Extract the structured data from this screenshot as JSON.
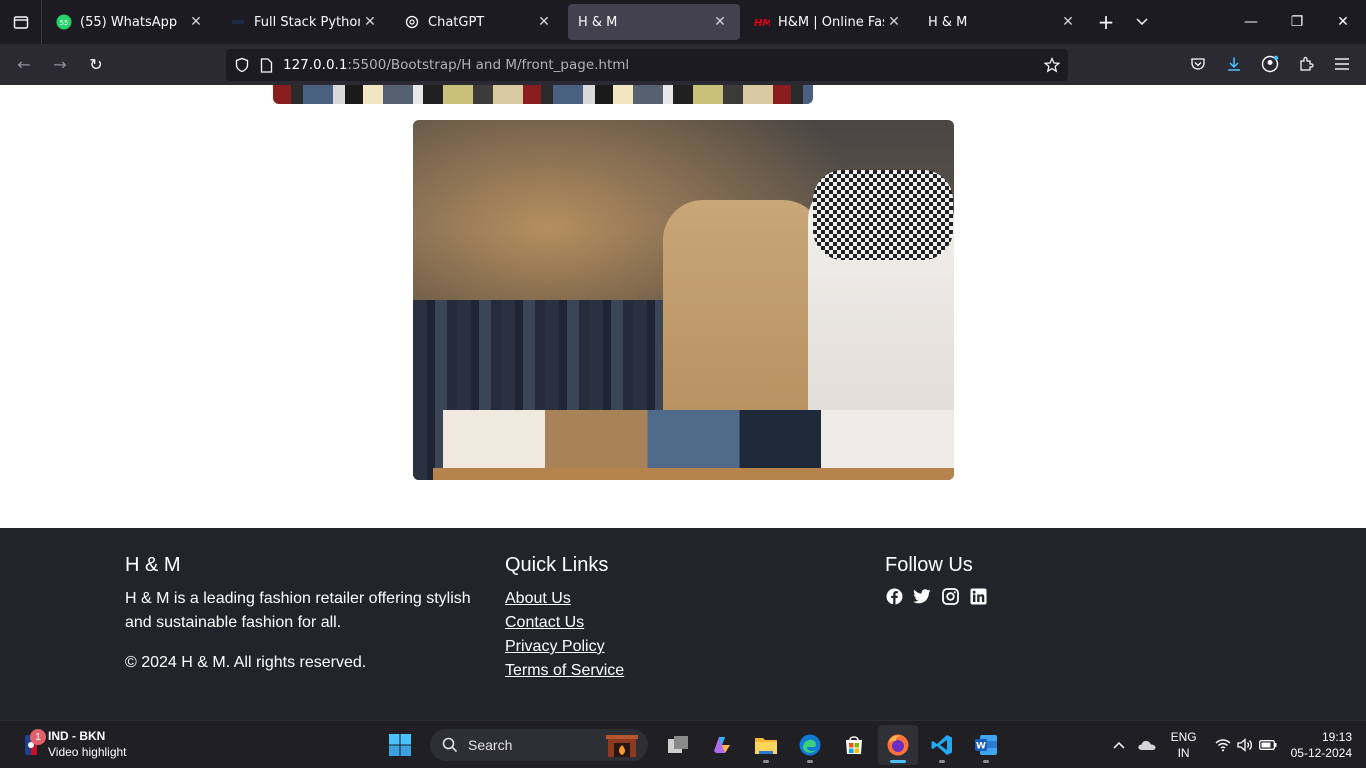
{
  "browser": {
    "tabs": [
      {
        "title": "(55) WhatsApp",
        "active": false
      },
      {
        "title": "Full Stack Python-Djan",
        "active": false
      },
      {
        "title": "ChatGPT",
        "active": false
      },
      {
        "title": "H & M",
        "active": true
      },
      {
        "title": "H&M | Online Fashion",
        "active": false
      },
      {
        "title": "H & M",
        "active": false
      }
    ],
    "whatsapp_badge": "55",
    "url_host": "127.0.0.1",
    "url_rest": ":5500/Bootstrap/H and M/front_page.html",
    "accent": "#4cc2ff"
  },
  "footer": {
    "brand_title": "H & M",
    "brand_description": "H & M is a leading fashion retailer offering stylish and sustainable fashion for all.",
    "copyright": "© 2024 H & M. All rights reserved.",
    "quick_links_title": "Quick Links",
    "quick_links": [
      "About Us",
      "Contact Us",
      "Privacy Policy",
      "Terms of Service"
    ],
    "follow_title": "Follow Us",
    "social_icons": [
      "facebook-icon",
      "twitter-icon",
      "instagram-icon",
      "linkedin-icon"
    ]
  },
  "taskbar": {
    "weather_badge": "1",
    "weather_line1": "IND - BKN",
    "weather_line2": "Video highlight",
    "search_label": "Search",
    "lang_line1": "ENG",
    "lang_line2": "IN",
    "time": "19:13",
    "date": "05-12-2024"
  }
}
